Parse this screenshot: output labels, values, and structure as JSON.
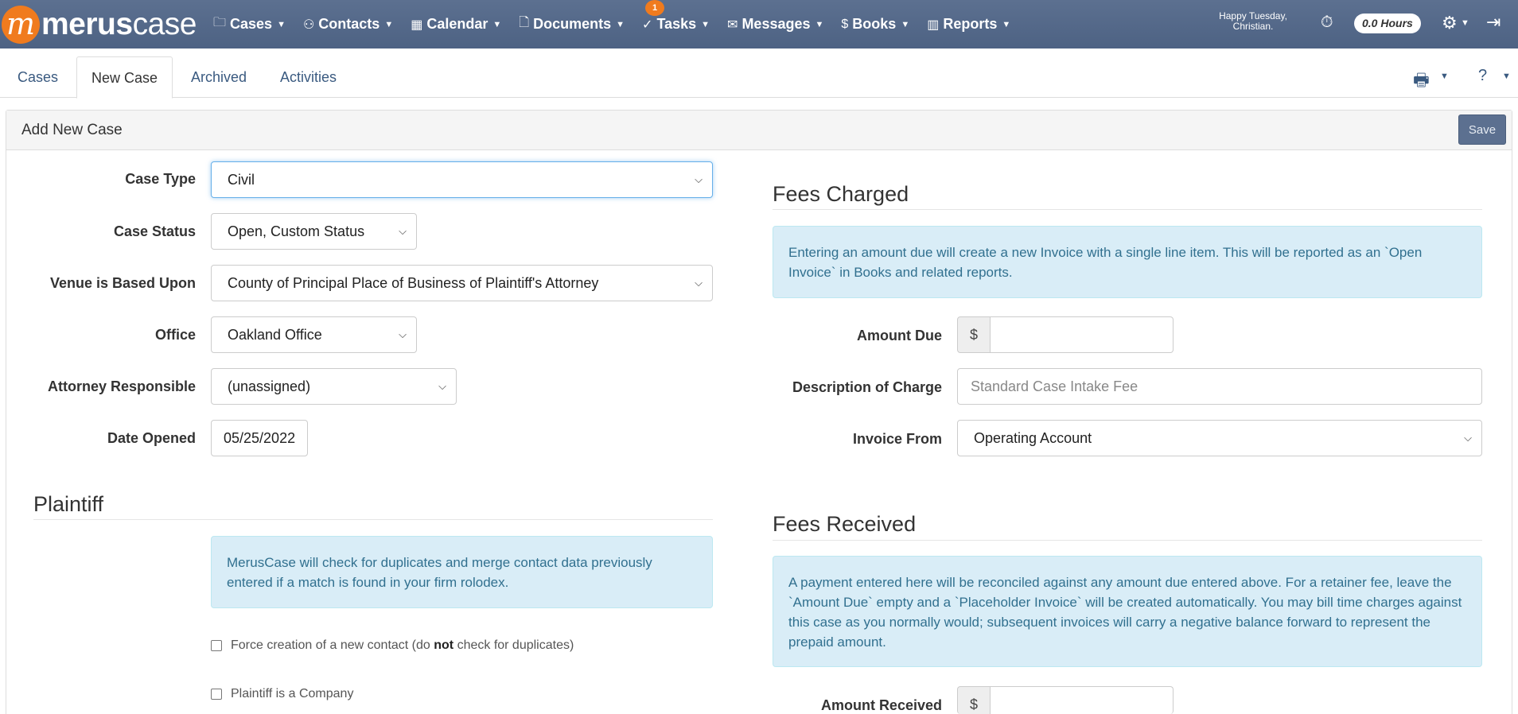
{
  "brand": {
    "name_bold": "merus",
    "name_light": "case",
    "mark": "m"
  },
  "nav": [
    {
      "icon": "▭",
      "label": "Cases"
    },
    {
      "icon": "👥",
      "label": "Contacts"
    },
    {
      "icon": "▦",
      "label": "Calendar"
    },
    {
      "icon": "▯",
      "label": "Documents"
    },
    {
      "icon": "✓",
      "label": "Tasks",
      "badge": "1"
    },
    {
      "icon": "✉",
      "label": "Messages"
    },
    {
      "icon": "$",
      "label": "Books"
    },
    {
      "icon": "▥",
      "label": "Reports"
    }
  ],
  "user": {
    "greeting_line1": "Happy Tuesday,",
    "greeting_line2": "Christian.",
    "hours": "0.0 Hours"
  },
  "tabs": [
    {
      "label": "Cases"
    },
    {
      "label": "New Case"
    },
    {
      "label": "Archived"
    },
    {
      "label": "Activities"
    }
  ],
  "panel": {
    "title": "Add New Case",
    "save_label": "Save"
  },
  "form": {
    "case_type": {
      "label": "Case Type",
      "value": "Civil"
    },
    "case_status": {
      "label": "Case Status",
      "value": "Open, Custom Status"
    },
    "venue": {
      "label": "Venue is Based Upon",
      "value": "County of Principal Place of Business of Plaintiff's Attorney"
    },
    "office": {
      "label": "Office",
      "value": "Oakland Office"
    },
    "attorney": {
      "label": "Attorney Responsible",
      "value": "(unassigned)"
    },
    "date_opened": {
      "label": "Date Opened",
      "value": "05/25/2022"
    }
  },
  "plaintiff": {
    "title": "Plaintiff",
    "info": "MerusCase will check for duplicates and merge contact data previously entered if a match is found in your firm rolodex.",
    "force_new_prefix": "Force creation of a new contact (do ",
    "force_new_bold": "not",
    "force_new_suffix": " check for duplicates)",
    "is_company": "Plaintiff is a Company"
  },
  "fees_charged": {
    "title": "Fees Charged",
    "info": "Entering an amount due will create a new Invoice with a single line item. This will be reported as an `Open Invoice` in Books and related reports.",
    "amount_due_label": "Amount Due",
    "currency": "$",
    "amount_due_value": "",
    "description_label": "Description of Charge",
    "description_placeholder": "Standard Case Intake Fee",
    "invoice_from_label": "Invoice From",
    "invoice_from_value": "Operating Account"
  },
  "fees_received": {
    "title": "Fees Received",
    "info": "A payment entered here will be reconciled against any amount due entered above. For a retainer fee, leave the `Amount Due` empty and a `Placeholder Invoice` will be created automatically. You may bill time charges against this case as you normally would; subsequent invoices will carry a negative balance forward to represent the prepaid amount.",
    "amount_received_label": "Amount Received",
    "currency": "$"
  }
}
